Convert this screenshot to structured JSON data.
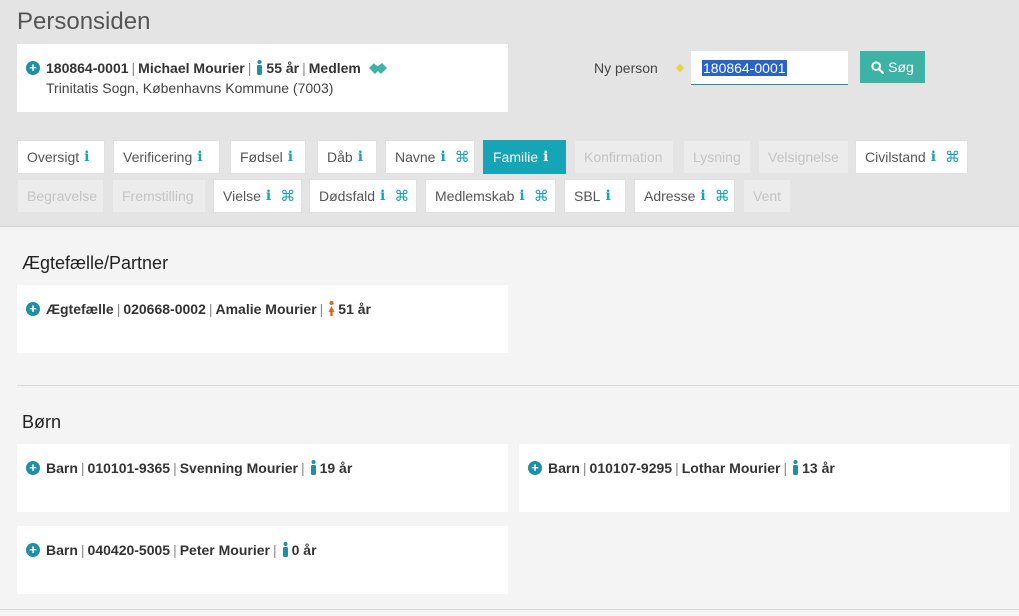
{
  "page_title": "Personsiden",
  "person": {
    "cpr": "180864-0001",
    "name": "Michael Mourier",
    "age": "55 år",
    "status": "Medlem",
    "address": "Trinitatis Sogn, Københavns Kommune (7003)"
  },
  "search": {
    "label": "Ny person",
    "value": "180864-0001",
    "button_label": "Søg"
  },
  "tabs": [
    {
      "label": "Oversigt",
      "state": "normal",
      "info": true,
      "cmd": false
    },
    {
      "label": "Verificering",
      "state": "normal",
      "info": true,
      "cmd": false
    },
    {
      "label": "Fødsel",
      "state": "normal",
      "info": true,
      "cmd": false
    },
    {
      "label": "Dåb",
      "state": "normal",
      "info": true,
      "cmd": false
    },
    {
      "label": "Navne",
      "state": "normal",
      "info": true,
      "cmd": true
    },
    {
      "label": "Familie",
      "state": "active",
      "info": true,
      "cmd": false
    },
    {
      "label": "Konfirmation",
      "state": "disabled",
      "info": false,
      "cmd": false
    },
    {
      "label": "Lysning",
      "state": "disabled",
      "info": false,
      "cmd": false
    },
    {
      "label": "Velsignelse",
      "state": "disabled",
      "info": false,
      "cmd": false
    },
    {
      "label": "Civilstand",
      "state": "normal",
      "info": true,
      "cmd": true
    },
    {
      "label": "Begravelse",
      "state": "disabled",
      "info": false,
      "cmd": false
    },
    {
      "label": "Fremstilling",
      "state": "disabled",
      "info": false,
      "cmd": false
    },
    {
      "label": "Vielse",
      "state": "normal",
      "info": true,
      "cmd": true
    },
    {
      "label": "Dødsfald",
      "state": "normal",
      "info": true,
      "cmd": true
    },
    {
      "label": "Medlemskab",
      "state": "normal",
      "info": true,
      "cmd": true
    },
    {
      "label": "SBL",
      "state": "normal",
      "info": true,
      "cmd": false
    },
    {
      "label": "Adresse",
      "state": "normal",
      "info": true,
      "cmd": true
    },
    {
      "label": "Vent",
      "state": "disabled",
      "info": false,
      "cmd": false
    }
  ],
  "info_glyph": "i",
  "cmd_glyph": "⌘",
  "sections": {
    "partner": {
      "title": "Ægtefælle/Partner",
      "items": [
        {
          "role": "Ægtefælle",
          "cpr": "020668-0002",
          "name": "Amalie Mourier",
          "age": "51 år",
          "gender": "female"
        }
      ]
    },
    "children": {
      "title": "Børn",
      "items": [
        {
          "role": "Barn",
          "cpr": "010101-9365",
          "name": "Svenning Mourier",
          "age": "19 år",
          "gender": "male"
        },
        {
          "role": "Barn",
          "cpr": "010107-9295",
          "name": "Lothar Mourier",
          "age": "13 år",
          "gender": "male"
        },
        {
          "role": "Barn",
          "cpr": "040420-5005",
          "name": "Peter Mourier",
          "age": "0 år",
          "gender": "male"
        }
      ]
    }
  },
  "colors": {
    "accent": "#15a5b7",
    "search_button": "#3db3a6",
    "male_icon": "#1d8fa6",
    "female_icon": "#e0651c"
  }
}
